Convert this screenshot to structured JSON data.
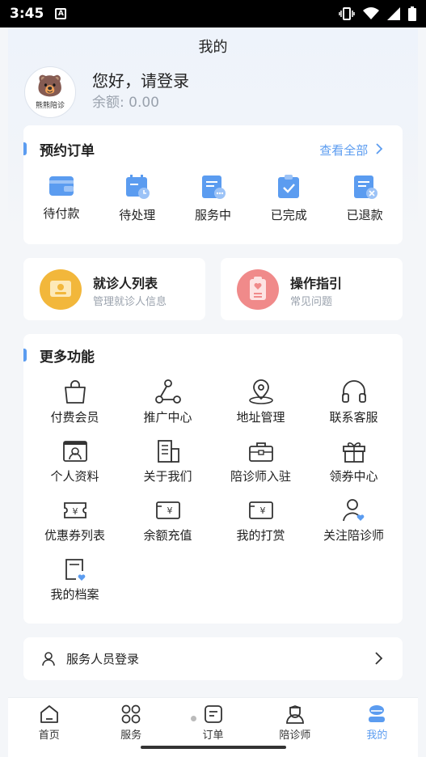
{
  "status": {
    "time": "3:45"
  },
  "page_title": "我的",
  "profile": {
    "greeting": "您好，请登录",
    "balance": "余额: 0.00",
    "brand": "熊熊陪诊"
  },
  "orders": {
    "title": "预约订单",
    "view_all": "查看全部",
    "items": [
      {
        "label": "待付款",
        "icon": "wallet-icon"
      },
      {
        "label": "待处理",
        "icon": "calendar-clock-icon"
      },
      {
        "label": "服务中",
        "icon": "document-chat-icon"
      },
      {
        "label": "已完成",
        "icon": "clipboard-check-icon"
      },
      {
        "label": "已退款",
        "icon": "document-cancel-icon"
      }
    ]
  },
  "patients": {
    "title": "就诊人列表",
    "subtitle": "管理就诊人信息"
  },
  "guide": {
    "title": "操作指引",
    "subtitle": "常见问题"
  },
  "more": {
    "title": "更多功能",
    "items": [
      {
        "label": "付费会员",
        "icon": "shopping-bag-icon"
      },
      {
        "label": "推广中心",
        "icon": "share-icon"
      },
      {
        "label": "地址管理",
        "icon": "location-pin-icon"
      },
      {
        "label": "联系客服",
        "icon": "headset-icon"
      },
      {
        "label": "个人资料",
        "icon": "id-card-icon"
      },
      {
        "label": "关于我们",
        "icon": "building-icon"
      },
      {
        "label": "陪诊师入驻",
        "icon": "briefcase-icon"
      },
      {
        "label": "领券中心",
        "icon": "gift-icon"
      },
      {
        "label": "优惠券列表",
        "icon": "coupon-icon"
      },
      {
        "label": "余额充值",
        "icon": "recharge-card-icon"
      },
      {
        "label": "我的打赏",
        "icon": "reward-card-icon"
      },
      {
        "label": "关注陪诊师",
        "icon": "user-heart-icon"
      },
      {
        "label": "我的档案",
        "icon": "file-heart-icon"
      }
    ]
  },
  "staff_login": {
    "label": "服务人员登录"
  },
  "tabs": [
    {
      "label": "首页",
      "icon": "home-icon"
    },
    {
      "label": "服务",
      "icon": "grid-icon"
    },
    {
      "label": "订单",
      "icon": "order-icon"
    },
    {
      "label": "陪诊师",
      "icon": "nurse-icon"
    },
    {
      "label": "我的",
      "icon": "profile-icon"
    }
  ],
  "colors": {
    "accent": "#5b9cf0",
    "patients_orange": "#f2b73b",
    "guide_red": "#f08a8a"
  }
}
